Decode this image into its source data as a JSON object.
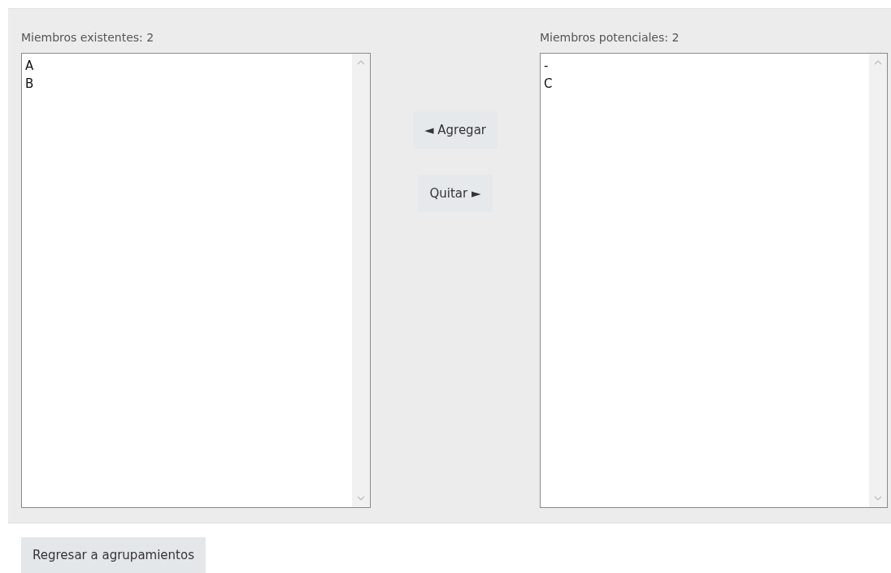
{
  "existing": {
    "label": "Miembros existentes: 2",
    "items": [
      "A",
      "B"
    ]
  },
  "actions": [
    {
      "label": "◄ Agregar"
    },
    {
      "label": "Quitar ►"
    }
  ],
  "potential": {
    "label": "Miembros potenciales: 2",
    "items": [
      "-",
      "C"
    ]
  },
  "back_button": {
    "label": "Regresar a agrupamientos"
  }
}
